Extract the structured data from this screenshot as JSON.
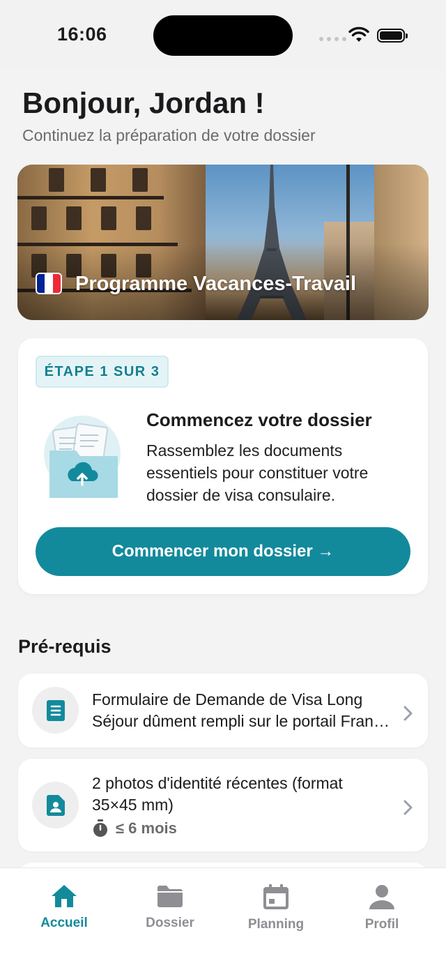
{
  "status_bar": {
    "time": "16:06"
  },
  "header": {
    "greeting": "Bonjour, Jordan !",
    "subtitle": "Continuez la préparation de votre dossier"
  },
  "hero": {
    "title": "Programme Vacances-Travail",
    "flag_colors": [
      "#002395",
      "#ffffff",
      "#ed2939"
    ]
  },
  "step_card": {
    "badge": "ÉTAPE 1 SUR 3",
    "title": "Commencez votre dossier",
    "description": "Rassemblez les documents essentiels pour constituer votre dossier de visa consulaire.",
    "button_label": "Commencer mon dossier →"
  },
  "prerequisites": {
    "section_title": "Pré-requis",
    "items": [
      {
        "line1": "Formulaire de Demande de Visa Long",
        "line2": "Séjour dûment rempli sur le portail France-Visas",
        "icon": "document-icon"
      },
      {
        "line1": "2 photos d'identité récentes (format",
        "line2": "35×45 mm)",
        "validity": "≤ 6 mois",
        "icon": "id-photo-icon"
      }
    ]
  },
  "tabbar": {
    "tabs": [
      {
        "label": "Accueil",
        "icon": "home-icon",
        "active": true
      },
      {
        "label": "Dossier",
        "icon": "folder-icon",
        "active": false
      },
      {
        "label": "Planning",
        "icon": "calendar-icon",
        "active": false
      },
      {
        "label": "Profil",
        "icon": "person-icon",
        "active": false
      }
    ]
  },
  "colors": {
    "accent": "#138a9c",
    "inactive": "#8e8e93",
    "background": "#f3f3f3"
  }
}
